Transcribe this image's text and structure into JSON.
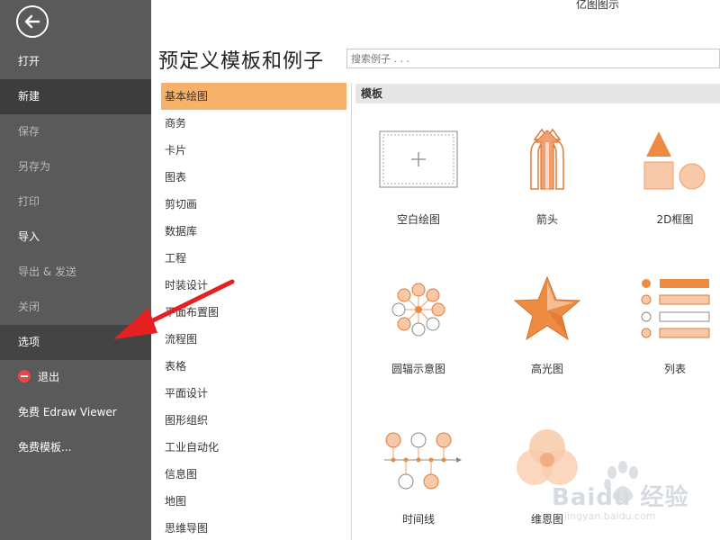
{
  "app_title": "亿图图示",
  "sidebar": {
    "back_icon": "back-arrow-icon",
    "items": [
      {
        "label": "打开",
        "state": "normal"
      },
      {
        "label": "新建",
        "state": "active"
      },
      {
        "label": "保存",
        "state": "dim"
      },
      {
        "label": "另存为",
        "state": "dim"
      },
      {
        "label": "打印",
        "state": "dim"
      },
      {
        "label": "导入",
        "state": "normal"
      },
      {
        "label": "导出 & 发送",
        "state": "dim"
      },
      {
        "label": "关闭",
        "state": "dim"
      },
      {
        "label": "选项",
        "state": "selected"
      },
      {
        "label": "退出",
        "state": "normal",
        "icon": "exit-icon"
      },
      {
        "label": "免费 Edraw Viewer",
        "state": "normal"
      },
      {
        "label": "免费模板...",
        "state": "normal"
      }
    ]
  },
  "main": {
    "title": "预定义模板和例子",
    "search_placeholder": "搜索例子 . . .",
    "categories": [
      "基本绘图",
      "商务",
      "卡片",
      "图表",
      "剪切画",
      "数据库",
      "工程",
      "时装设计",
      "平面布置图",
      "流程图",
      "表格",
      "平面设计",
      "图形组织",
      "工业自动化",
      "信息图",
      "地图",
      "思维导图"
    ],
    "active_category": "基本绘图",
    "templates_header": "模板",
    "templates": [
      {
        "label": "空白绘图",
        "icon": "blank-drawing-icon"
      },
      {
        "label": "箭头",
        "icon": "arrows-icon"
      },
      {
        "label": "2D框图",
        "icon": "2d-block-icon"
      },
      {
        "label": "圆辐示意图",
        "icon": "radial-diagram-icon"
      },
      {
        "label": "高光图",
        "icon": "highlight-star-icon"
      },
      {
        "label": "列表",
        "icon": "list-icon"
      },
      {
        "label": "时间线",
        "icon": "timeline-icon"
      },
      {
        "label": "维恩图",
        "icon": "venn-icon"
      }
    ]
  },
  "colors": {
    "accent_orange": "#ee8b42",
    "light_orange": "#f8c9a8",
    "selected_category": "#f6b26b",
    "annotation_red": "#e52020"
  },
  "watermark": {
    "text": "Baidu 经验",
    "subtext": "jingyan.baidu.com"
  }
}
